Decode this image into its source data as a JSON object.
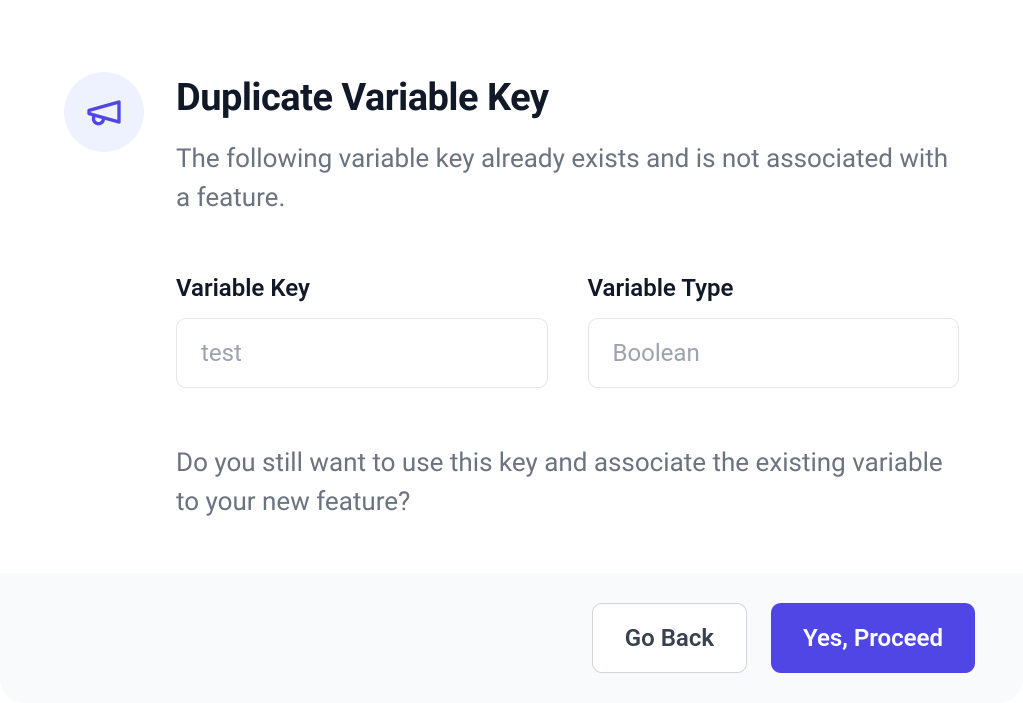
{
  "modal": {
    "title": "Duplicate Variable Key",
    "description": "The following variable key already exists and is not associated with a feature.",
    "question": "Do you still want to use this key and associate the existing variable to your new feature?",
    "fields": {
      "variableKey": {
        "label": "Variable Key",
        "value": "test"
      },
      "variableType": {
        "label": "Variable Type",
        "value": "Boolean"
      }
    },
    "buttons": {
      "back": "Go Back",
      "proceed": "Yes, Proceed"
    }
  }
}
